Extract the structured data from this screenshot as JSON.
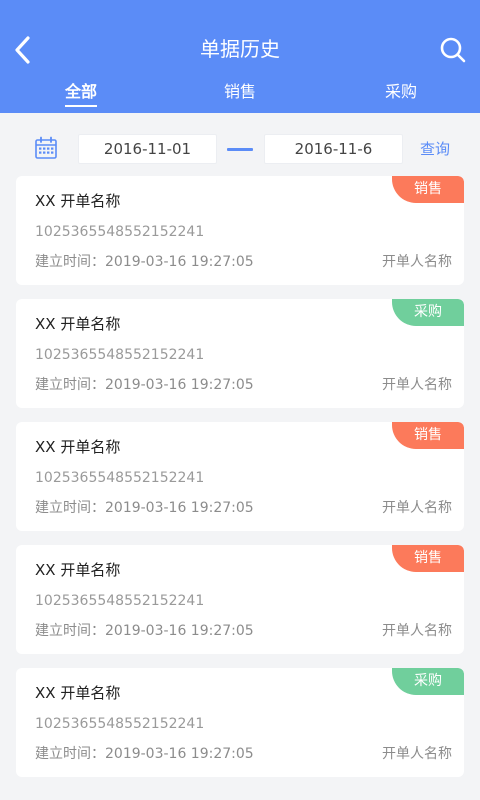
{
  "header": {
    "title": "单据历史",
    "back_icon": "chevron-left-icon",
    "search_icon": "search-icon",
    "color": "#5b8cf7"
  },
  "tabs": [
    {
      "label": "全部",
      "active": true
    },
    {
      "label": "销售",
      "active": false
    },
    {
      "label": "采购",
      "active": false
    }
  ],
  "filter": {
    "calendar_icon": "calendar-icon",
    "date_from": "2016-11-01",
    "date_to": "2016-11-6",
    "query_label": "查询"
  },
  "badge_colors": {
    "销售": "#fc7a5b",
    "采购": "#70cf9c"
  },
  "records": [
    {
      "name": "XX 开单名称",
      "code": "1025365548552152241",
      "time_label": "建立时间：",
      "time": "2019-03-16 19:27:05",
      "creator": "开单人名称",
      "type": "销售"
    },
    {
      "name": "XX 开单名称",
      "code": "1025365548552152241",
      "time_label": "建立时间：",
      "time": "2019-03-16 19:27:05",
      "creator": "开单人名称",
      "type": "采购"
    },
    {
      "name": "XX 开单名称",
      "code": "1025365548552152241",
      "time_label": "建立时间：",
      "time": "2019-03-16 19:27:05",
      "creator": "开单人名称",
      "type": "销售"
    },
    {
      "name": "XX 开单名称",
      "code": "1025365548552152241",
      "time_label": "建立时间：",
      "time": "2019-03-16 19:27:05",
      "creator": "开单人名称",
      "type": "销售"
    },
    {
      "name": "XX 开单名称",
      "code": "1025365548552152241",
      "time_label": "建立时间：",
      "time": "2019-03-16 19:27:05",
      "creator": "开单人名称",
      "type": "采购"
    }
  ]
}
